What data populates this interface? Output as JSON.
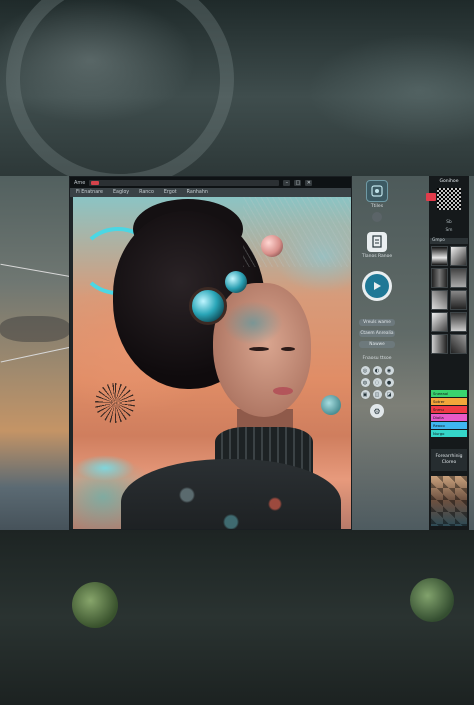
{
  "colors": {
    "accent_red": "#e23c4b",
    "play_blue": "#1f7896",
    "panel_dark": "#15191b",
    "window_dark": "#2c3337"
  },
  "window": {
    "app_name": "Ame",
    "url_text": "",
    "controls": [
      "–",
      "□",
      "✕"
    ]
  },
  "menu": {
    "items": [
      "Fi Enatnare",
      "Eagloy",
      "Ranco",
      "Ergot",
      "Ranhahn"
    ]
  },
  "tool_panel": {
    "top_label": "Ttiles",
    "badge_label": "Tlanos Ranoe",
    "play_icon": "play-icon",
    "pills": [
      "Vreuls wame",
      "Ctaem Anrealia",
      "Nawwe"
    ],
    "section_label": "Fnaosu ttsoe",
    "icons": [
      "◎",
      "◐",
      "◉",
      "◍",
      "◌",
      "●",
      "▣",
      "◫",
      "◪"
    ],
    "settings_icon": "gear-icon"
  },
  "right_panel": {
    "header": "Gonihoe",
    "sub1": "Sb",
    "sub2": "Sm",
    "tab_label": "Gmpo",
    "swatches": [
      {
        "label": "Sneeaol",
        "color": "#39d46f"
      },
      {
        "label": "Sotrer",
        "color": "#f2a63a"
      },
      {
        "label": "Snmu",
        "color": "#f03b47"
      },
      {
        "label": "Diolla",
        "color": "#e85ac8"
      },
      {
        "label": "Reaoo",
        "color": "#3fb6f0"
      },
      {
        "label": "Nurgo",
        "color": "#35d6c9"
      }
    ],
    "button_label": "Forearrhinig Cloreo"
  }
}
